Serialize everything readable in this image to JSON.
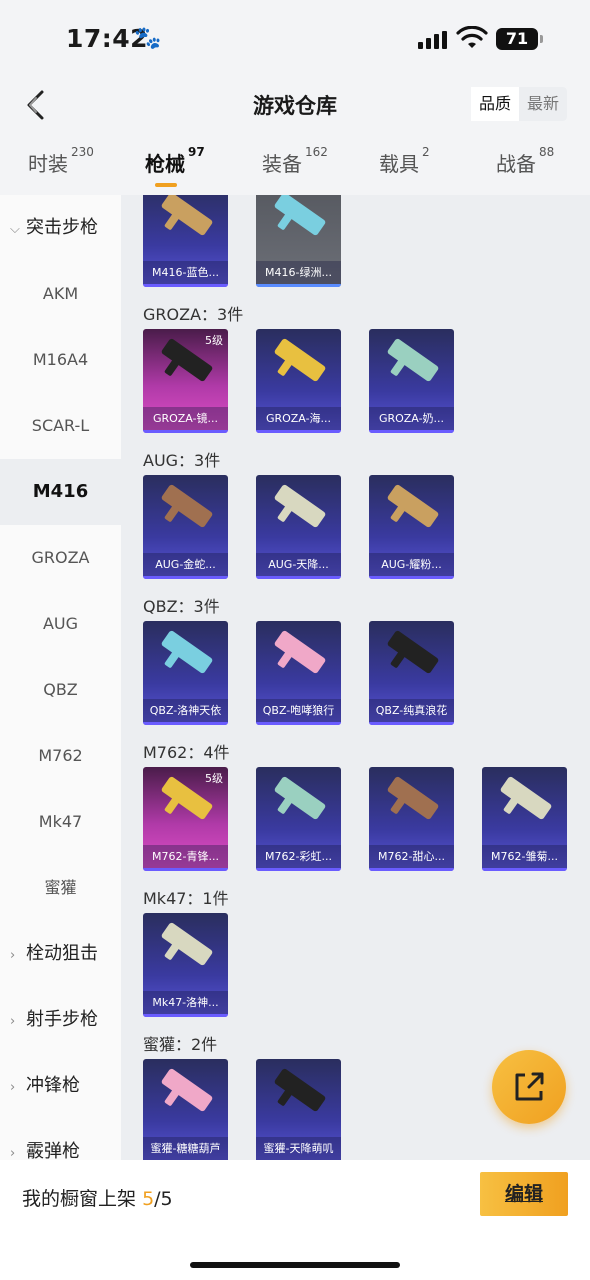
{
  "status_bar": {
    "time": "17:42",
    "battery": "71"
  },
  "header": {
    "title": "游戏仓库",
    "sort_options": [
      "品质",
      "最新"
    ]
  },
  "tabs": [
    {
      "label": "时装",
      "count": "230"
    },
    {
      "label": "枪械",
      "count": "97"
    },
    {
      "label": "装备",
      "count": "162"
    },
    {
      "label": "载具",
      "count": "2"
    },
    {
      "label": "战备",
      "count": "88"
    }
  ],
  "sidebar": {
    "group_open": "突击步枪",
    "items": [
      "AKM",
      "M16A4",
      "SCAR-L",
      "M416",
      "GROZA",
      "AUG",
      "QBZ",
      "M762",
      "Mk47",
      "蜜獾"
    ],
    "groups_closed": [
      "栓动狙击",
      "射手步枪",
      "冲锋枪",
      "霰弹枪"
    ]
  },
  "sections": [
    {
      "label": "",
      "items": [
        {
          "name": "M416-蓝色...",
          "style": "blue",
          "level": ""
        },
        {
          "name": "M416-绿洲...",
          "style": "gray",
          "level": ""
        }
      ]
    },
    {
      "label": "GROZA：3件",
      "items": [
        {
          "name": "GROZA-镜...",
          "style": "pink",
          "level": "5级"
        },
        {
          "name": "GROZA-海...",
          "style": "blue",
          "level": ""
        },
        {
          "name": "GROZA-奶...",
          "style": "blue",
          "level": ""
        }
      ]
    },
    {
      "label": "AUG：3件",
      "items": [
        {
          "name": "AUG-金蛇...",
          "style": "blue",
          "level": ""
        },
        {
          "name": "AUG-天降...",
          "style": "blue",
          "level": ""
        },
        {
          "name": "AUG-耀粉...",
          "style": "blue",
          "level": ""
        }
      ]
    },
    {
      "label": "QBZ：3件",
      "items": [
        {
          "name": "QBZ-洛神天依",
          "style": "blue",
          "level": ""
        },
        {
          "name": "QBZ-咆哮狼行",
          "style": "blue",
          "level": ""
        },
        {
          "name": "QBZ-纯真浪花",
          "style": "blue",
          "level": ""
        }
      ]
    },
    {
      "label": "M762：4件",
      "items": [
        {
          "name": "M762-青锋...",
          "style": "pink",
          "level": "5级"
        },
        {
          "name": "M762-彩虹...",
          "style": "blue",
          "level": ""
        },
        {
          "name": "M762-甜心...",
          "style": "blue",
          "level": ""
        },
        {
          "name": "M762-雏菊...",
          "style": "blue",
          "level": ""
        }
      ]
    },
    {
      "label": "Mk47：1件",
      "items": [
        {
          "name": "Mk47-洛神...",
          "style": "blue",
          "level": ""
        }
      ]
    },
    {
      "label": "蜜獾：2件",
      "items": [
        {
          "name": "蜜獾-糖糖葫芦",
          "style": "blue",
          "level": ""
        },
        {
          "name": "蜜獾-天降萌叽",
          "style": "blue",
          "level": ""
        }
      ]
    }
  ],
  "bottom_bar": {
    "label": "我的橱窗上架",
    "current": "5",
    "total": "/5",
    "edit_label": "编辑"
  },
  "colors": {
    "accent": "#f0a020",
    "sidebar_active_bg": "#eceef1"
  }
}
